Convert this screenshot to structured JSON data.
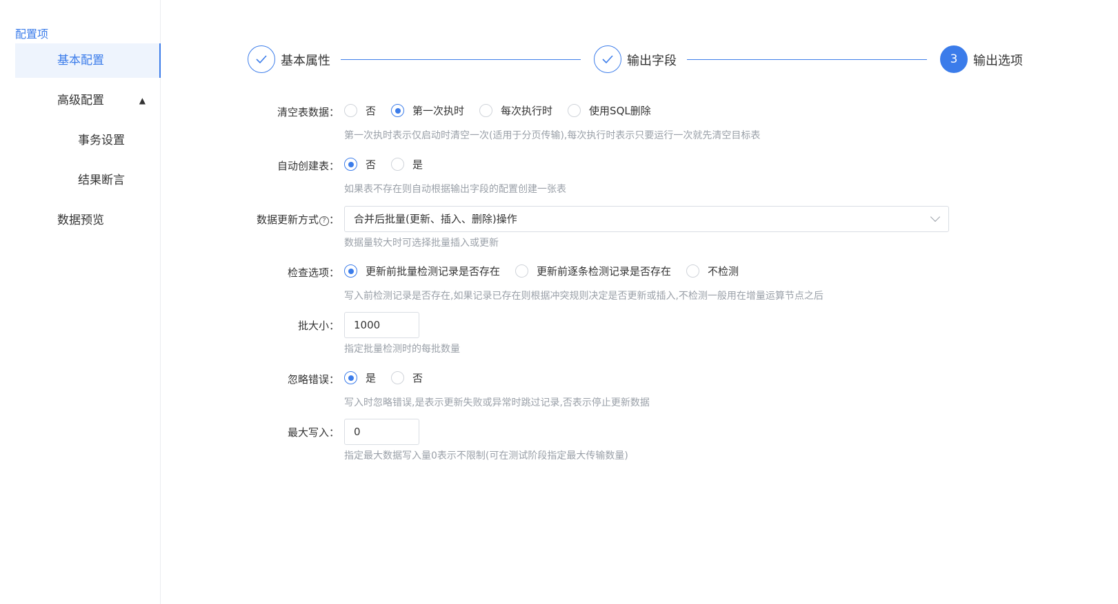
{
  "sidebar": {
    "title": "配置项",
    "items": [
      {
        "label": "基本配置",
        "active": true
      },
      {
        "label": "高级配置",
        "expanded": true,
        "chevron": "▲"
      },
      {
        "label": "事务设置"
      },
      {
        "label": "结果断言"
      },
      {
        "label": "数据预览"
      }
    ]
  },
  "steps": [
    {
      "label": "基本属性",
      "state": "done",
      "icon": "✓"
    },
    {
      "label": "输出字段",
      "state": "done",
      "icon": "✓"
    },
    {
      "label": "输出选项",
      "state": "current",
      "number": "3"
    }
  ],
  "form": {
    "clear_table": {
      "label": "清空表数据：",
      "options": [
        "否",
        "第一次执时",
        "每次执行时",
        "使用SQL删除"
      ],
      "selected": 1,
      "hint": "第一次执时表示仅启动时清空一次(适用于分页传输),每次执行时表示只要运行一次就先清空目标表"
    },
    "auto_create": {
      "label": "自动创建表：",
      "options": [
        "否",
        "是"
      ],
      "selected": 0,
      "hint": "如果表不存在则自动根据输出字段的配置创建一张表"
    },
    "update_mode": {
      "label": "数据更新方式",
      "help": "?",
      "colon": "：",
      "value": "合并后批量(更新、插入、删除)操作",
      "hint": "数据量较大时可选择批量插入或更新"
    },
    "check_option": {
      "label": "检查选项：",
      "options": [
        "更新前批量检测记录是否存在",
        "更新前逐条检测记录是否存在",
        "不检测"
      ],
      "selected": 0,
      "hint": "写入前检测记录是否存在,如果记录已存在则根据冲突规则决定是否更新或插入,不检测一般用在增量运算节点之后"
    },
    "batch_size": {
      "label": "批大小：",
      "value": "1000",
      "hint": "指定批量检测时的每批数量"
    },
    "ignore_error": {
      "label": "忽略错误：",
      "options": [
        "是",
        "否"
      ],
      "selected": 0,
      "hint": "写入时忽略错误,是表示更新失败或异常时跳过记录,否表示停止更新数据"
    },
    "max_write": {
      "label": "最大写入：",
      "value": "0",
      "hint": "指定最大数据写入量0表示不限制(可在测试阶段指定最大传输数量)"
    }
  },
  "colors": {
    "accent": "#3b7cea",
    "hint": "#9aa0a8",
    "border": "#d9dde3"
  }
}
